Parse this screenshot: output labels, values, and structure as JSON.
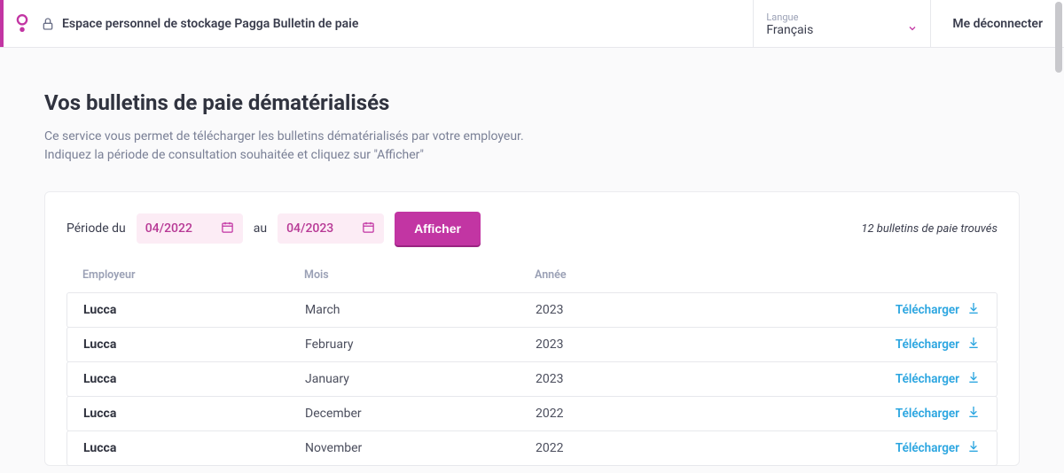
{
  "header": {
    "title": "Espace personnel de stockage Pagga Bulletin de paie",
    "langLabel": "Langue",
    "langValue": "Français",
    "logout": "Me déconnecter"
  },
  "main": {
    "heading": "Vos bulletins de paie dématérialisés",
    "descLine1": "Ce service vous permet de télécharger les bulletins dématérialisés par votre employeur.",
    "descLine2": "Indiquez la période de consultation souhaitée et cliquez sur \"Afficher\""
  },
  "filter": {
    "periodLabel": "Période du",
    "fromValue": "04/2022",
    "toLabel": "au",
    "toValue": "04/2023",
    "buttonLabel": "Afficher",
    "resultText": "12 bulletins de paie trouvés"
  },
  "table": {
    "headers": {
      "employer": "Employeur",
      "month": "Mois",
      "year": "Année"
    },
    "downloadLabel": "Télécharger",
    "rows": [
      {
        "employer": "Lucca",
        "month": "March",
        "year": "2023"
      },
      {
        "employer": "Lucca",
        "month": "February",
        "year": "2023"
      },
      {
        "employer": "Lucca",
        "month": "January",
        "year": "2023"
      },
      {
        "employer": "Lucca",
        "month": "December",
        "year": "2022"
      },
      {
        "employer": "Lucca",
        "month": "November",
        "year": "2022"
      }
    ]
  }
}
